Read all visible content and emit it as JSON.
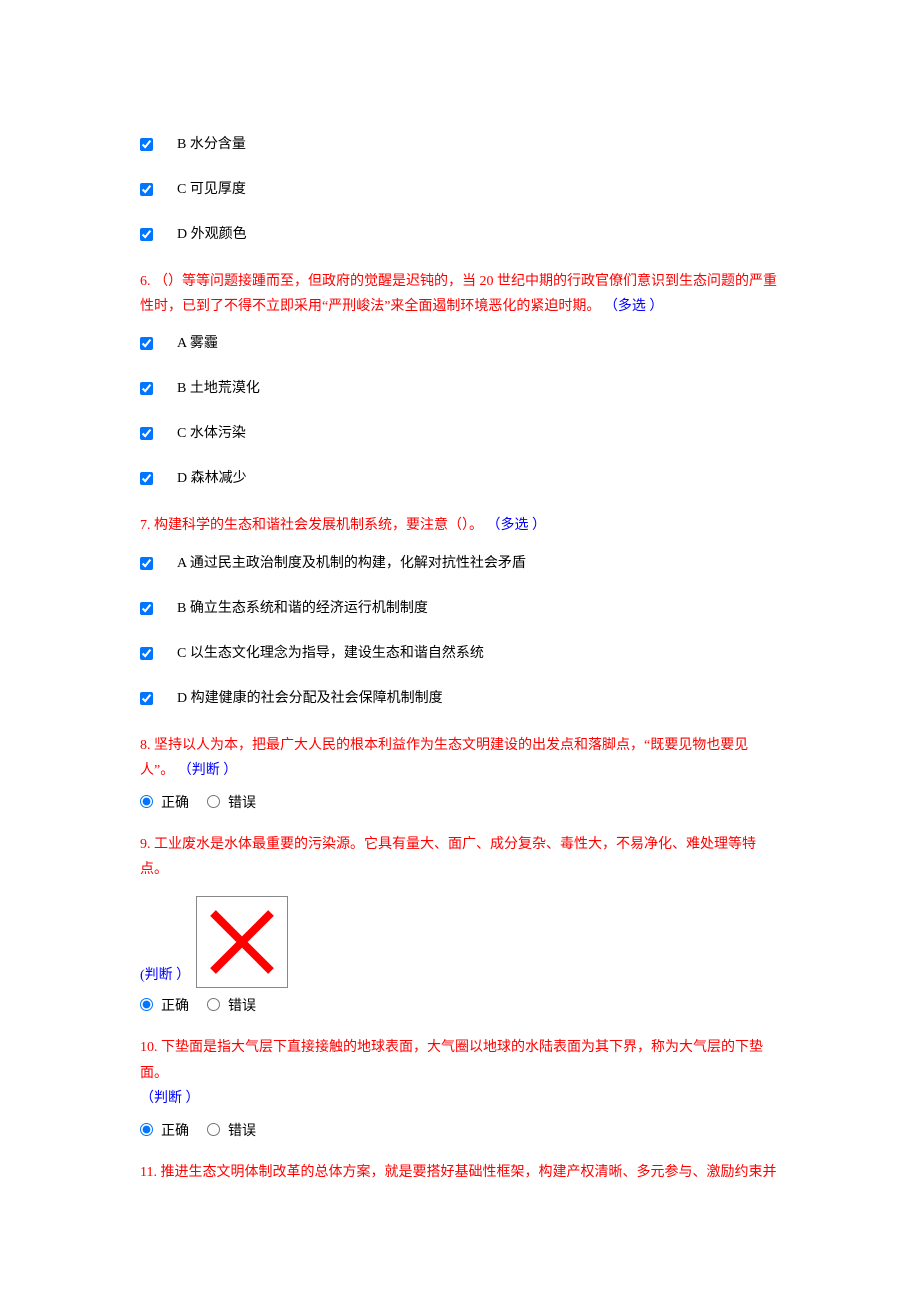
{
  "q5": {
    "optionB": "B 水分含量",
    "optionC": "C 可见厚度",
    "optionD": "D 外观颜色"
  },
  "q6": {
    "prefix": "6. ",
    "text": "（）等等问题接踵而至，但政府的觉醒是迟钝的，当 20 世纪中期的行政官僚们意识到生态问题的严重性时，已到了不得不立即采用“严刑峻法”来全面遏制环境恶化的紧迫时期。 ",
    "tag": "（多选 ）",
    "optionA": "A 雾霾",
    "optionB": "B 土地荒漠化",
    "optionC": "C 水体污染",
    "optionD": "D 森林减少"
  },
  "q7": {
    "prefix": "7. ",
    "text": "构建科学的生态和谐社会发展机制系统，要注意（）。 ",
    "tag": "（多选 ）",
    "optionA": "A 通过民主政治制度及机制的构建，化解对抗性社会矛盾",
    "optionB": "B 确立生态系统和谐的经济运行机制制度",
    "optionC": "C 以生态文化理念为指导，建设生态和谐自然系统",
    "optionD": "D 构建健康的社会分配及社会保障机制制度"
  },
  "q8": {
    "prefix": "8. ",
    "text": "坚持以人为本，把最广大人民的根本利益作为生态文明建设的出发点和落脚点，“既要见物也要见人”。 ",
    "tag": "（判断 ）"
  },
  "q9": {
    "prefix": "9. ",
    "text": "工业废水是水体最重要的污染源。它具有量大、面广、成分复杂、毒性大，不易净化、难处理等特点。",
    "tag": "(判断 ）"
  },
  "q10": {
    "prefix": "10. ",
    "text": "下垫面是指大气层下直接接触的地球表面，大气圈以地球的水陆表面为其下界，称为大气层的下垫面。",
    "tag": "（判断 ）"
  },
  "q11": {
    "prefix": "11. ",
    "text": "推进生态文明体制改革的总体方案，就是要搭好基础性框架，构建产权清晰、多元参与、激励约束并"
  },
  "tf": {
    "true": "正确",
    "false": "错误"
  }
}
